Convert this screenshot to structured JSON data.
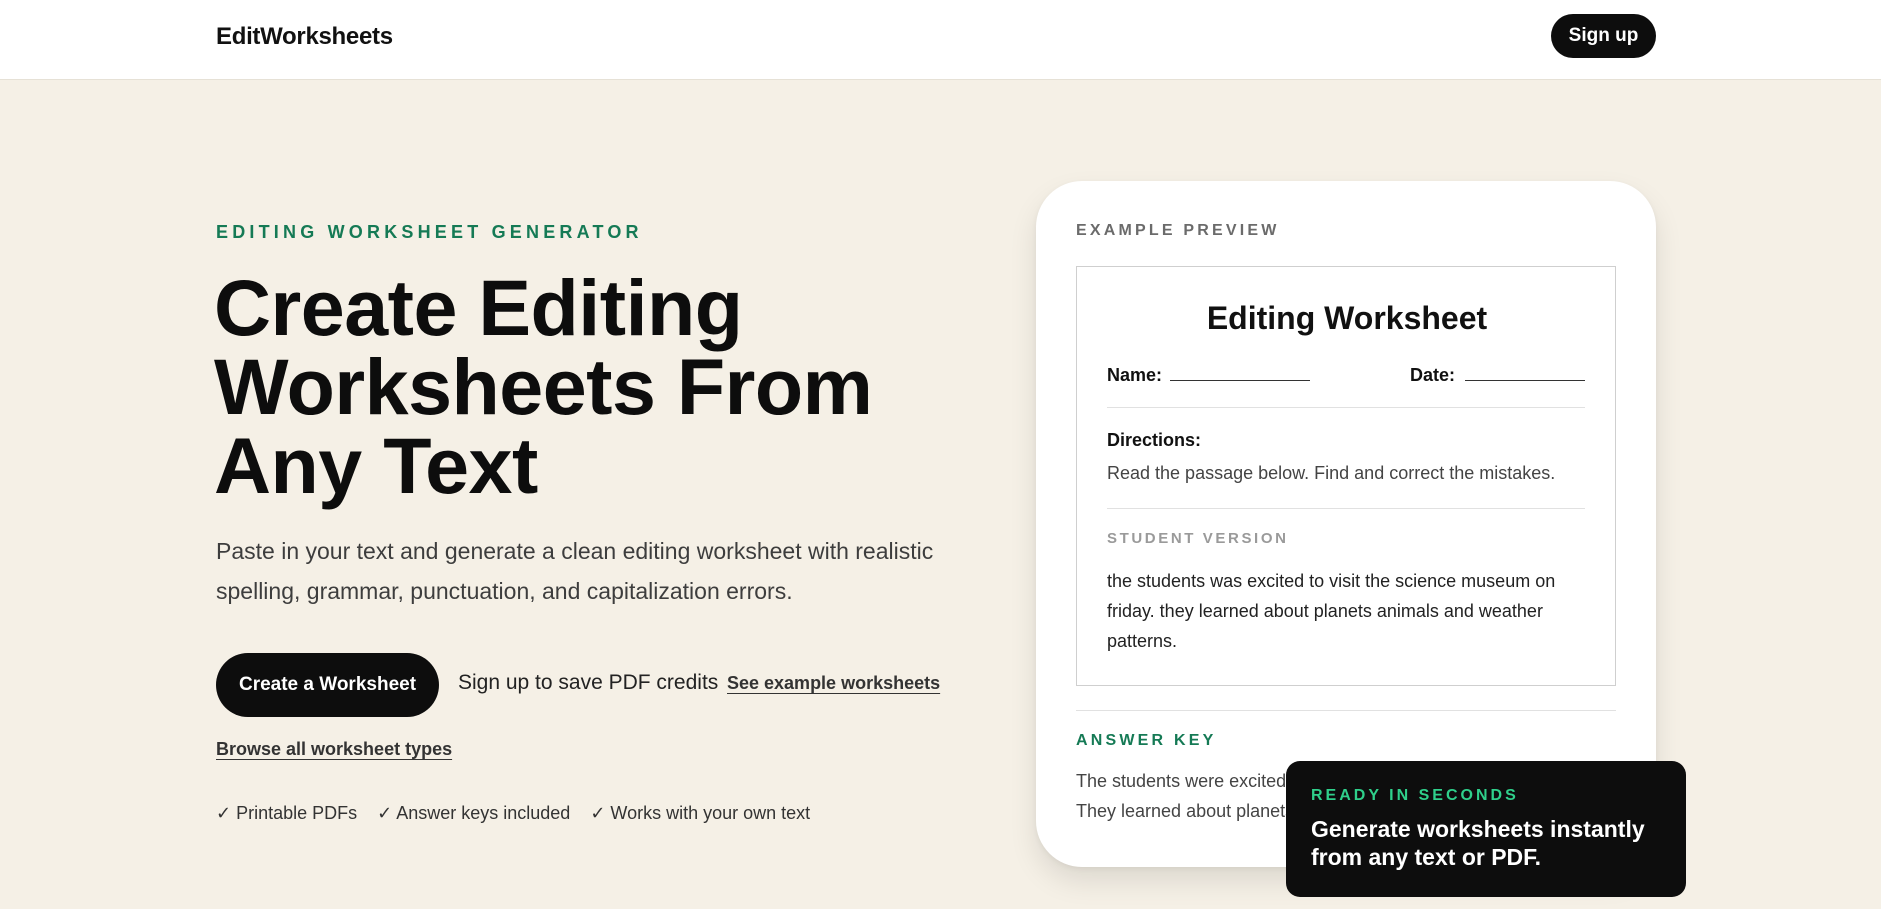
{
  "header": {
    "brand": "EditWorksheets",
    "signup_label": "Sign up"
  },
  "hero": {
    "eyebrow": "EDITING WORKSHEET GENERATOR",
    "title_line1": "Create Editing",
    "title_line2": "Worksheets From",
    "title_line3": "Any Text",
    "subtitle": "Paste in your text and generate a clean editing worksheet with realistic spelling, grammar, punctuation, and capitalization errors.",
    "cta_label": "Create a Worksheet",
    "save_note": "Sign up to save PDF credits",
    "examples_link": "See example worksheets",
    "browse_link": "Browse all worksheet types",
    "features": [
      "✓ Printable PDFs",
      "✓ Answer keys included",
      "✓ Works with your own text"
    ]
  },
  "preview": {
    "label": "EXAMPLE PREVIEW",
    "sheet": {
      "title": "Editing Worksheet",
      "name_label": "Name:",
      "date_label": "Date:",
      "directions_label": "Directions:",
      "directions_text": "Read the passage below. Find and correct the mistakes.",
      "student_label": "STUDENT VERSION",
      "student_text": "the students was excited to visit the science museum on friday. they learned about planets animals and weather patterns."
    },
    "answer_key_label": "ANSWER KEY",
    "answer_key_line1": "The students were excited t",
    "answer_key_line2": "They learned about planets"
  },
  "toast": {
    "label": "READY IN SECONDS",
    "text": "Generate worksheets instantly from any text or PDF."
  },
  "colors": {
    "page_background": "#f5f0e6",
    "accent_green": "#157a55",
    "toast_green": "#2fd08b",
    "button_black": "#0d0d0d"
  }
}
